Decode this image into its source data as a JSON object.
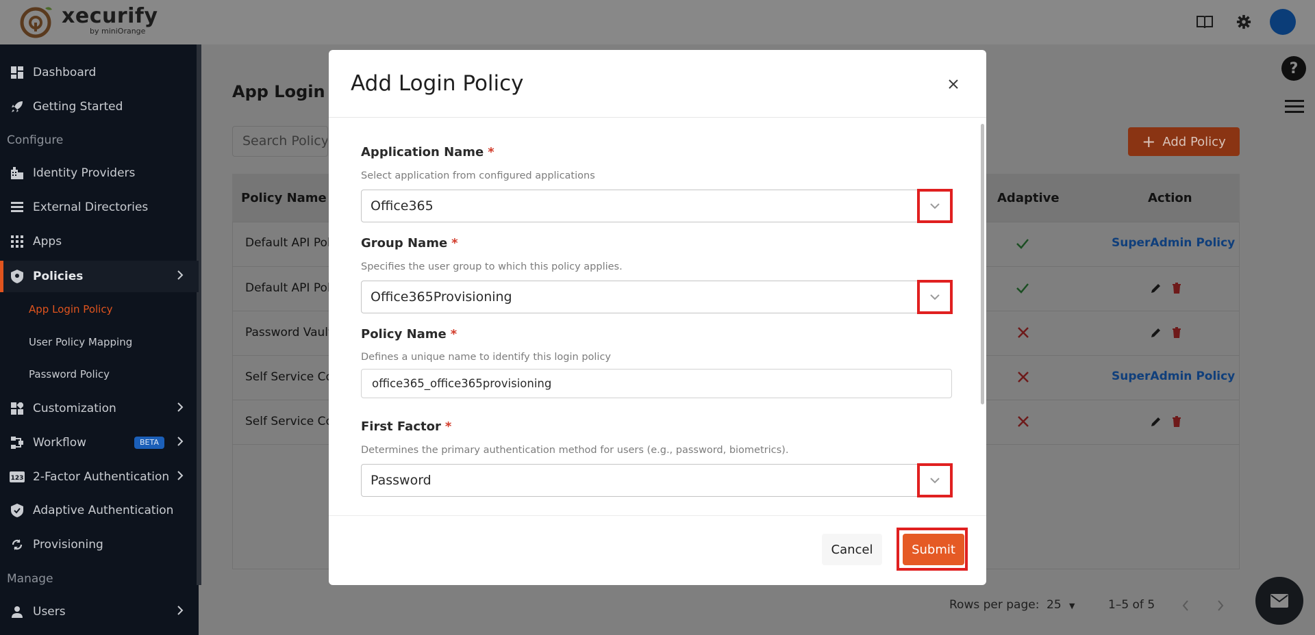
{
  "header": {
    "brand": "xecurify",
    "brand_sub": "by miniOrange",
    "icons": [
      "book-icon",
      "gear-icon",
      "avatar"
    ]
  },
  "sidebar": {
    "items": [
      {
        "label": "Dashboard",
        "icon": "dashboard-icon"
      },
      {
        "label": "Getting Started",
        "icon": "rocket-icon"
      },
      {
        "label": "Identity Providers",
        "icon": "building-icon"
      },
      {
        "label": "External Directories",
        "icon": "list-icon"
      },
      {
        "label": "Apps",
        "icon": "apps-grid-icon"
      },
      {
        "label": "Policies",
        "icon": "policy-shield-icon",
        "active": true
      },
      {
        "label": "Customization",
        "icon": "widgets-icon"
      },
      {
        "label": "Workflow",
        "icon": "workflow-icon",
        "badge": "BETA"
      },
      {
        "label": "2-Factor Authentication",
        "icon": "123-icon"
      },
      {
        "label": "Adaptive Authentication",
        "icon": "shield-check-icon"
      },
      {
        "label": "Provisioning",
        "icon": "sync-icon"
      },
      {
        "label": "Users",
        "icon": "person-icon"
      }
    ],
    "sections": {
      "configure": "Configure",
      "manage": "Manage"
    },
    "policies_sub": [
      "App Login Policy",
      "User Policy Mapping",
      "Password Policy"
    ]
  },
  "page": {
    "title": "App Login P",
    "search_placeholder": "Search Policy",
    "add_policy": "Add Policy",
    "columns": {
      "policy_name": "Policy Name",
      "adaptive": "Adaptive",
      "action": "Action"
    },
    "rows": [
      {
        "name": "Default API Poli",
        "adaptive": "check",
        "action": "SuperAdmin Policy"
      },
      {
        "name": "Default API Poli",
        "adaptive": "check",
        "action": "edit-delete"
      },
      {
        "name": "Password Vault",
        "adaptive": "cross",
        "action": "edit-delete"
      },
      {
        "name": "Self Service Co",
        "adaptive": "cross",
        "action": "SuperAdmin Policy"
      },
      {
        "name": "Self Service Co",
        "adaptive": "cross",
        "action": "edit-delete"
      }
    ],
    "pager": {
      "rows_per_page_label": "Rows per page:",
      "rows_per_page": "25",
      "range": "1–5 of 5"
    }
  },
  "modal": {
    "title": "Add Login Policy",
    "fields": {
      "application": {
        "label": "Application Name",
        "required": "*",
        "help": "Select application from configured applications",
        "value": "Office365"
      },
      "group": {
        "label": "Group Name",
        "required": "*",
        "help": "Specifies the user group to which this policy applies.",
        "value": "Office365Provisioning"
      },
      "policy_name": {
        "label": "Policy Name",
        "required": "*",
        "help": "Defines a unique name to identify this login policy",
        "value": "office365_office365provisioning"
      },
      "first_factor": {
        "label": "First Factor",
        "required": "*",
        "help": "Determines the primary authentication method for users (e.g., password, biometrics).",
        "value": "Password"
      }
    },
    "cancel": "Cancel",
    "submit": "Submit"
  },
  "colors": {
    "accent": "#e55a25",
    "highlight": "#e02020",
    "sidebar_bg": "#0d131d",
    "link": "#1565c0"
  }
}
